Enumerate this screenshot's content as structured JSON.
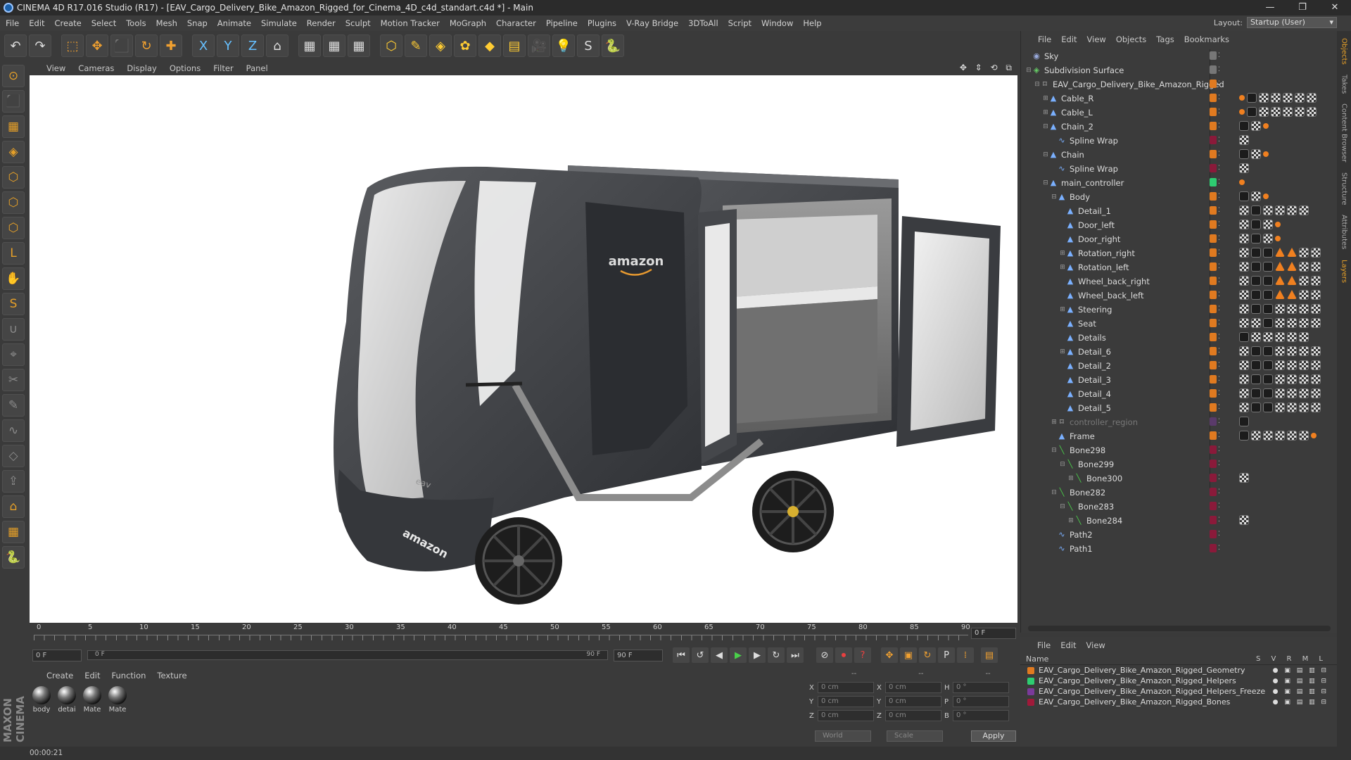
{
  "window": {
    "title": "CINEMA 4D R17.016 Studio (R17) - [EAV_Cargo_Delivery_Bike_Amazon_Rigged_for_Cinema_4D_c4d_standart.c4d *] - Main",
    "controls": [
      "—",
      "❐",
      "✕"
    ]
  },
  "menu": [
    "File",
    "Edit",
    "Create",
    "Select",
    "Tools",
    "Mesh",
    "Snap",
    "Animate",
    "Simulate",
    "Render",
    "Sculpt",
    "Motion Tracker",
    "MoGraph",
    "Character",
    "Pipeline",
    "Plugins",
    "V-Ray Bridge",
    "3DToAll",
    "Script",
    "Window",
    "Help"
  ],
  "layout": {
    "label": "Layout:",
    "value": "Startup (User)"
  },
  "toolbar_icons": [
    "undo-icon",
    "redo-icon",
    "live-select-icon",
    "move-icon",
    "scale-icon",
    "rotate-icon",
    "create-object-icon",
    "x-axis-icon",
    "y-axis-icon",
    "z-axis-icon",
    "coordinate-system-icon",
    "render-view-icon",
    "render-picture-viewer-icon",
    "edit-render-settings-icon",
    "cube-icon",
    "pen-icon",
    "subdivision-icon",
    "array-icon",
    "deformer-icon",
    "floor-icon",
    "camera-icon",
    "light-icon",
    "snap-icon",
    "python-icon"
  ],
  "toolbar_glyphs": [
    "↶",
    "↷",
    "⬚",
    "✥",
    "⬛",
    "↻",
    "✚",
    "X",
    "Y",
    "Z",
    "⌂",
    "▦",
    "▦",
    "▦",
    "⬡",
    "✎",
    "◈",
    "✿",
    "◆",
    "▤",
    "🎥",
    "💡",
    "S",
    "🐍"
  ],
  "viewport_menu": [
    "View",
    "Cameras",
    "Display",
    "Options",
    "Filter",
    "Panel"
  ],
  "viewport_icons": "✥ ⇕ ⟲ ⧉",
  "scene": {
    "brand_label": "amazon",
    "front_label": "amazon",
    "logo_small": "eav"
  },
  "timeline": {
    "ticks": [
      "0",
      "5",
      "10",
      "15",
      "20",
      "25",
      "30",
      "35",
      "40",
      "45",
      "50",
      "55",
      "60",
      "65",
      "70",
      "75",
      "80",
      "85",
      "90"
    ],
    "current": "0 F"
  },
  "transport": {
    "start": "0 F",
    "range_start": "0 F",
    "range_end": "90 F",
    "end": "90 F"
  },
  "materials": {
    "menu": [
      "Create",
      "Edit",
      "Function",
      "Texture"
    ],
    "items": [
      "body",
      "detai",
      "Mate",
      "Mate"
    ]
  },
  "coordinates": {
    "rows": [
      {
        "a": "X",
        "av": "0 cm",
        "b": "X",
        "bv": "0 cm",
        "c": "H",
        "cv": "0 °"
      },
      {
        "a": "Y",
        "av": "0 cm",
        "b": "Y",
        "bv": "0 cm",
        "c": "P",
        "cv": "0 °"
      },
      {
        "a": "Z",
        "av": "0 cm",
        "b": "Z",
        "bv": "0 cm",
        "c": "B",
        "cv": "0 °"
      }
    ],
    "world": "World",
    "scale": "Scale",
    "apply": "Apply",
    "dashes": "--"
  },
  "status": {
    "time": "00:00:21"
  },
  "brand": "MAXON CINEMA 4D",
  "objects": {
    "menu": [
      "File",
      "Edit",
      "View",
      "Objects",
      "Tags",
      "Bookmarks"
    ],
    "tree": [
      {
        "name": "Sky",
        "level": 0,
        "icon": "sky",
        "color": "#777",
        "tags": []
      },
      {
        "name": "Subdivision Surface",
        "level": 0,
        "icon": "subdiv",
        "color": "#777",
        "tags": [],
        "exp": "−"
      },
      {
        "name": "EAV_Cargo_Delivery_Bike_Amazon_Rigged",
        "level": 1,
        "icon": "null",
        "color": "#e07a20",
        "tags": [],
        "exp": "−"
      },
      {
        "name": "Cable_R",
        "level": 2,
        "icon": "poly",
        "color": "#e07a20",
        "tags": [
          "sm",
          "tag",
          "ck",
          "ck",
          "ck",
          "ck",
          "ck"
        ],
        "exp": "+"
      },
      {
        "name": "Cable_L",
        "level": 2,
        "icon": "poly",
        "color": "#e07a20",
        "tags": [
          "sm",
          "tag",
          "ck",
          "ck",
          "ck",
          "ck",
          "ck"
        ],
        "exp": "+"
      },
      {
        "name": "Chain_2",
        "level": 2,
        "icon": "poly",
        "color": "#e07a20",
        "tags": [
          "tag",
          "ck",
          "sm"
        ],
        "exp": "−"
      },
      {
        "name": "Spline Wrap",
        "level": 3,
        "icon": "spline",
        "color": "#8a1a3a",
        "tags": [
          "ck"
        ]
      },
      {
        "name": "Chain",
        "level": 2,
        "icon": "poly",
        "color": "#e07a20",
        "tags": [
          "tag",
          "ck",
          "sm"
        ],
        "exp": "−"
      },
      {
        "name": "Spline Wrap",
        "level": 3,
        "icon": "spline",
        "color": "#8a1a3a",
        "tags": [
          "ck"
        ]
      },
      {
        "name": "main_controller",
        "level": 2,
        "icon": "poly",
        "color": "#2ecc71",
        "tags": [
          "sm"
        ],
        "exp": "−"
      },
      {
        "name": "Body",
        "level": 3,
        "icon": "poly",
        "color": "#e07a20",
        "tags": [
          "tag",
          "ck",
          "sm"
        ],
        "exp": "−"
      },
      {
        "name": "Detail_1",
        "level": 4,
        "icon": "poly",
        "color": "#e07a20",
        "tags": [
          "ck",
          "tag",
          "ck",
          "ck",
          "ck",
          "ck"
        ]
      },
      {
        "name": "Door_left",
        "level": 4,
        "icon": "poly",
        "color": "#e07a20",
        "tags": [
          "ck",
          "tag",
          "ck",
          "sm"
        ]
      },
      {
        "name": "Door_right",
        "level": 4,
        "icon": "poly",
        "color": "#e07a20",
        "tags": [
          "ck",
          "tag",
          "ck",
          "sm"
        ]
      },
      {
        "name": "Rotation_right",
        "level": 4,
        "icon": "poly",
        "color": "#e07a20",
        "tags": [
          "ck",
          "tag",
          "tag",
          "tri",
          "tri",
          "ck",
          "ck"
        ],
        "exp": "+"
      },
      {
        "name": "Rotation_left",
        "level": 4,
        "icon": "poly",
        "color": "#e07a20",
        "tags": [
          "ck",
          "tag",
          "tag",
          "tri",
          "tri",
          "ck",
          "ck"
        ],
        "exp": "+"
      },
      {
        "name": "Wheel_back_right",
        "level": 4,
        "icon": "poly",
        "color": "#e07a20",
        "tags": [
          "ck",
          "tag",
          "tag",
          "tri",
          "tri",
          "ck",
          "ck"
        ]
      },
      {
        "name": "Wheel_back_left",
        "level": 4,
        "icon": "poly",
        "color": "#e07a20",
        "tags": [
          "ck",
          "tag",
          "tag",
          "tri",
          "tri",
          "ck",
          "ck"
        ]
      },
      {
        "name": "Steering",
        "level": 4,
        "icon": "poly",
        "color": "#e07a20",
        "tags": [
          "ck",
          "tag",
          "tag",
          "ck",
          "ck",
          "ck",
          "ck"
        ],
        "exp": "+"
      },
      {
        "name": "Seat",
        "level": 4,
        "icon": "poly",
        "color": "#e07a20",
        "tags": [
          "ck",
          "ck",
          "tag",
          "ck",
          "ck",
          "ck",
          "ck"
        ]
      },
      {
        "name": "Details",
        "level": 4,
        "icon": "poly",
        "color": "#e07a20",
        "tags": [
          "tag",
          "ck",
          "ck",
          "ck",
          "ck",
          "ck"
        ]
      },
      {
        "name": "Detail_6",
        "level": 4,
        "icon": "poly",
        "color": "#e07a20",
        "tags": [
          "ck",
          "tag",
          "tag",
          "ck",
          "ck",
          "ck",
          "ck"
        ],
        "exp": "+"
      },
      {
        "name": "Detail_2",
        "level": 4,
        "icon": "poly",
        "color": "#e07a20",
        "tags": [
          "ck",
          "tag",
          "tag",
          "ck",
          "ck",
          "ck",
          "ck"
        ]
      },
      {
        "name": "Detail_3",
        "level": 4,
        "icon": "poly",
        "color": "#e07a20",
        "tags": [
          "ck",
          "tag",
          "tag",
          "ck",
          "ck",
          "ck",
          "ck"
        ]
      },
      {
        "name": "Detail_4",
        "level": 4,
        "icon": "poly",
        "color": "#e07a20",
        "tags": [
          "ck",
          "tag",
          "tag",
          "ck",
          "ck",
          "ck",
          "ck"
        ]
      },
      {
        "name": "Detail_5",
        "level": 4,
        "icon": "poly",
        "color": "#e07a20",
        "tags": [
          "ck",
          "tag",
          "tag",
          "ck",
          "ck",
          "ck",
          "ck"
        ]
      },
      {
        "name": "controller_region",
        "level": 3,
        "icon": "null",
        "color": "#5a3a6a",
        "tags": [
          "tag"
        ],
        "dim": true,
        "exp": "+"
      },
      {
        "name": "Frame",
        "level": 3,
        "icon": "poly",
        "color": "#e07a20",
        "tags": [
          "tag",
          "ck",
          "ck",
          "ck",
          "ck",
          "ck",
          "sm"
        ]
      },
      {
        "name": "Bone298",
        "level": 3,
        "icon": "bone",
        "color": "#8a1a3a",
        "tags": [],
        "exp": "−"
      },
      {
        "name": "Bone299",
        "level": 4,
        "icon": "bone",
        "color": "#8a1a3a",
        "tags": [],
        "exp": "−"
      },
      {
        "name": "Bone300",
        "level": 5,
        "icon": "bone",
        "color": "#8a1a3a",
        "tags": [
          "ck"
        ],
        "exp": "+"
      },
      {
        "name": "Bone282",
        "level": 3,
        "icon": "bone",
        "color": "#8a1a3a",
        "tags": [],
        "exp": "−"
      },
      {
        "name": "Bone283",
        "level": 4,
        "icon": "bone",
        "color": "#8a1a3a",
        "tags": [],
        "exp": "−"
      },
      {
        "name": "Bone284",
        "level": 5,
        "icon": "bone",
        "color": "#8a1a3a",
        "tags": [
          "ck"
        ],
        "exp": "+"
      },
      {
        "name": "Path2",
        "level": 3,
        "icon": "spline",
        "color": "#8a1a3a",
        "tags": []
      },
      {
        "name": "Path1",
        "level": 3,
        "icon": "spline",
        "color": "#8a1a3a",
        "tags": []
      }
    ]
  },
  "layers": {
    "menu": [
      "File",
      "Edit",
      "View"
    ],
    "header": "Name",
    "flags": "S V R M L",
    "items": [
      {
        "name": "EAV_Cargo_Delivery_Bike_Amazon_Rigged_Geometry",
        "color": "#e07a20"
      },
      {
        "name": "EAV_Cargo_Delivery_Bike_Amazon_Rigged_Helpers",
        "color": "#2ecc71"
      },
      {
        "name": "EAV_Cargo_Delivery_Bike_Amazon_Rigged_Helpers_Freeze",
        "color": "#7a3a9a"
      },
      {
        "name": "EAV_Cargo_Delivery_Bike_Amazon_Rigged_Bones",
        "color": "#a01a3a"
      }
    ]
  },
  "sidetabs": [
    "Objects",
    "Takes",
    "Content Browser",
    "Structure",
    "Attributes",
    "Layers"
  ],
  "tool_icons_left": [
    "viewport-solo-icon",
    "model-mode-icon",
    "texture-mode-icon",
    "workplane-icon",
    "points-mode-icon",
    "edges-mode-icon",
    "polygons-mode-icon",
    "axis-icon",
    "tweak-icon",
    "soft-selection-icon",
    "magnet-icon",
    "snap-icon",
    "knife-icon",
    "brush-icon",
    "smooth-icon",
    "bevel-icon",
    "extrude-icon",
    "paint-icon",
    "lock-icon",
    "python-icon"
  ],
  "tool_glyphs_left": [
    "⊙",
    "⬛",
    "▦",
    "◈",
    "⬡",
    "⬡",
    "⬡",
    "L",
    "✋",
    "S",
    "∪",
    "⌖",
    "✂",
    "✎",
    "∿",
    "◇",
    "⇪",
    "⌂",
    "▦",
    "🐍"
  ]
}
